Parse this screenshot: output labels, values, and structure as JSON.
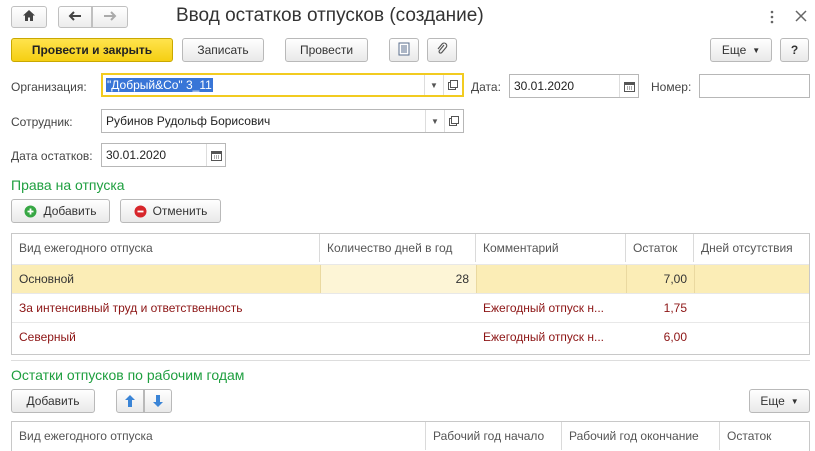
{
  "window": {
    "title": "Ввод остатков отпусков (создание)"
  },
  "toolbar": {
    "post_close": "Провести и закрыть",
    "save": "Записать",
    "post": "Провести",
    "more": "Еще",
    "help": "?"
  },
  "form": {
    "org_label": "Организация:",
    "org_value": "\"Добрый&Со\" 3_11",
    "date_label": "Дата:",
    "date_value": "30.01.2020",
    "number_label": "Номер:",
    "number_value": "",
    "employee_label": "Сотрудник:",
    "employee_value": "Рубинов Рудольф Борисович",
    "balance_date_label": "Дата остатков:",
    "balance_date_value": "30.01.2020"
  },
  "rights": {
    "title": "Права на отпуска",
    "add": "Добавить",
    "cancel": "Отменить",
    "columns": [
      "Вид ежегодного отпуска",
      "Количество дней в год",
      "Комментарий",
      "Остаток",
      "Дней отсутствия"
    ],
    "rows": [
      {
        "type": "Основной",
        "days": "28",
        "comment": "",
        "balance": "7,00",
        "absence": ""
      },
      {
        "type": "За интенсивный труд и ответственность",
        "days": "",
        "comment": "Ежегодный отпуск н...",
        "balance": "1,75",
        "absence": ""
      },
      {
        "type": "Северный",
        "days": "",
        "comment": "Ежегодный отпуск н...",
        "balance": "6,00",
        "absence": ""
      }
    ]
  },
  "balances": {
    "title": "Остатки отпусков по рабочим годам",
    "add": "Добавить",
    "more": "Еще",
    "columns": [
      "Вид ежегодного отпуска",
      "Рабочий год начало",
      "Рабочий год окончание",
      "Остаток"
    ]
  },
  "colors": {
    "accent_green": "#1e9f3f",
    "primary_yellow": "#f5cf12",
    "selected_row": "#fbedb6",
    "text_red": "#8c1414"
  }
}
